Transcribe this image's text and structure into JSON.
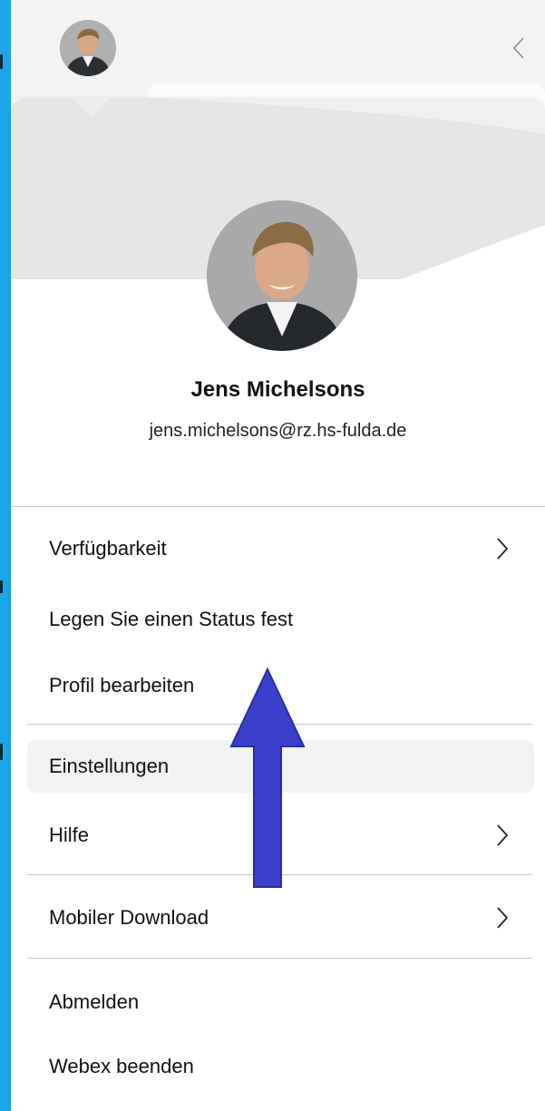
{
  "user": {
    "name": "Jens Michelsons",
    "email": "jens.michelsons@rz.hs-fulda.de"
  },
  "menu": [
    {
      "label": "Verfügbarkeit",
      "has_submenu": true
    },
    {
      "label": "Legen Sie einen Status fest",
      "has_submenu": false
    },
    {
      "label": "Profil bearbeiten",
      "has_submenu": false
    },
    {
      "label": "Einstellungen",
      "has_submenu": false,
      "highlighted": true
    },
    {
      "label": "Hilfe",
      "has_submenu": true
    },
    {
      "label": "Mobiler Download",
      "has_submenu": true
    },
    {
      "label": "Abmelden",
      "has_submenu": false
    },
    {
      "label": "Webex beenden",
      "has_submenu": false
    }
  ],
  "colors": {
    "accent_strip": "#1aa6e8",
    "annotation_arrow": "#3b3fcc",
    "hover_bg": "#f2f2f2"
  },
  "icons": {
    "collapse": "chevron-left-icon",
    "submenu": "chevron-right-icon",
    "annotation": "up-arrow-icon"
  }
}
